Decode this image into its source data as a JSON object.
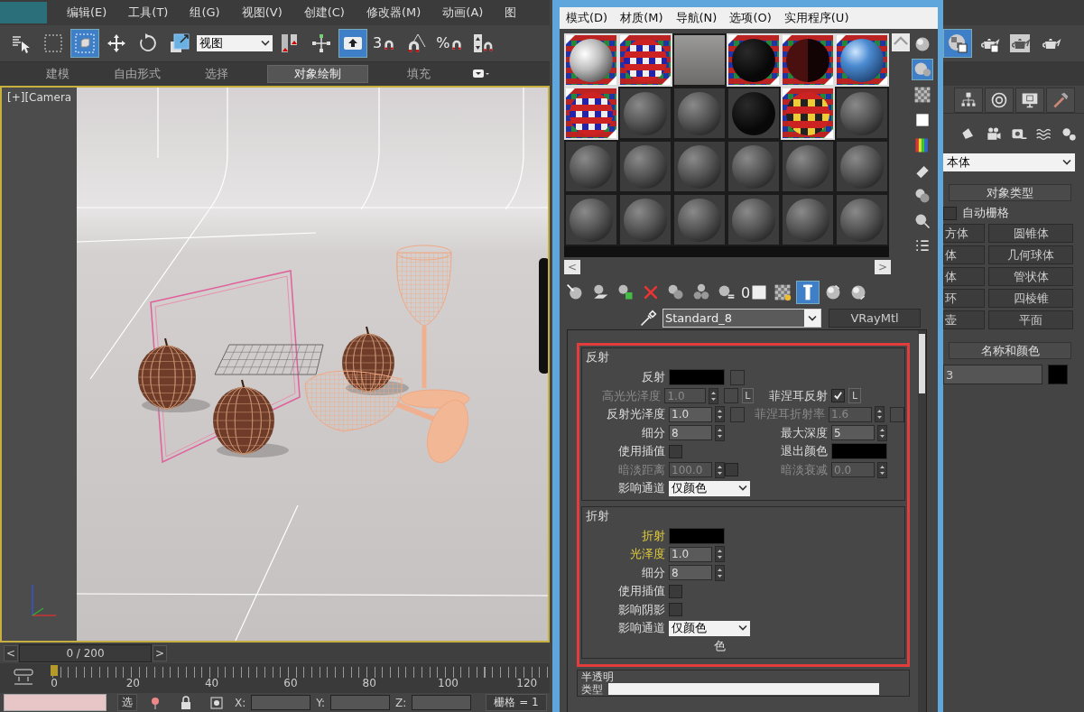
{
  "main_menu": [
    "编辑(E)",
    "工具(T)",
    "组(G)",
    "视图(V)",
    "创建(C)",
    "修改器(M)",
    "动画(A)",
    "图"
  ],
  "main_toolbar": [
    {
      "kind": "select",
      "active": false
    },
    {
      "kind": "region",
      "active": false
    },
    {
      "kind": "crossing",
      "active": true
    },
    {
      "kind": "move",
      "active": false
    },
    {
      "kind": "rotate",
      "active": false
    },
    {
      "kind": "scale",
      "active": false
    },
    {
      "kind": "dropdown",
      "value": "视图"
    },
    {
      "kind": "pivot",
      "active": false
    },
    {
      "kind": "manipulate",
      "active": false
    },
    {
      "kind": "shortcut",
      "active": true
    },
    {
      "kind": "snap",
      "label": "3",
      "active": false
    },
    {
      "kind": "angle-snap",
      "active": false
    },
    {
      "kind": "percent-snap",
      "label": "%",
      "active": false
    },
    {
      "kind": "spinner-snap",
      "active": false
    }
  ],
  "ribbon_tabs": [
    {
      "label": "建模",
      "selected": false
    },
    {
      "label": "自由形式",
      "selected": false
    },
    {
      "label": "选择",
      "selected": false
    },
    {
      "label": "对象绘制",
      "selected": true
    },
    {
      "label": "填充",
      "selected": false
    }
  ],
  "viewport": {
    "label": "[+][Camera",
    "active": true
  },
  "time_slider": {
    "prev": "<",
    "position": "0 / 200",
    "next": ">",
    "level": 0
  },
  "track_bar": {
    "labels": [
      "0",
      "20",
      "40",
      "60",
      "80",
      "100",
      "120"
    ]
  },
  "status_bar": {
    "mode": "选",
    "x_label": "X:",
    "y_label": "Y:",
    "z_label": "Z:",
    "grid": "栅格 = 1"
  },
  "command_panel": {
    "toolbar": [
      {
        "kind": "material-editor",
        "active": true
      },
      {
        "kind": "render-setup",
        "active": false
      },
      {
        "kind": "rendered-frame",
        "active": false
      },
      {
        "kind": "render",
        "active": false
      }
    ],
    "tabs": [
      {
        "kind": "hierarchy"
      },
      {
        "kind": "motion"
      },
      {
        "kind": "display"
      },
      {
        "kind": "utilities"
      }
    ],
    "categories": [
      {
        "kind": "light"
      },
      {
        "kind": "camera"
      },
      {
        "kind": "helper"
      },
      {
        "kind": "space-warp"
      },
      {
        "kind": "system"
      }
    ],
    "type_dropdown": "本体",
    "object_type": {
      "title": "对象类型",
      "autogrid": {
        "label": "自动栅格",
        "checked": false
      },
      "buttons": [
        "方体",
        "圆锥体",
        "体",
        "几何球体",
        "体",
        "管状体",
        "环",
        "四棱锥",
        "壶",
        "平面"
      ]
    },
    "name_color": {
      "title": "名称和颜色",
      "name": "3",
      "color": "#000000"
    }
  },
  "material_editor": {
    "menu": [
      "模式(D)",
      "材质(M)",
      "导航(N)",
      "选项(O)",
      "实用程序(U)"
    ],
    "slots": [
      {
        "kind": "white",
        "in_scene": true
      },
      {
        "kind": "checker",
        "in_scene": true
      },
      {
        "kind": "photo",
        "in_scene": false
      },
      {
        "kind": "black",
        "in_scene": true
      },
      {
        "kind": "dark-red",
        "in_scene": true
      },
      {
        "kind": "blue",
        "in_scene": true
      },
      {
        "kind": "checker",
        "in_scene": true
      },
      {
        "kind": "grey",
        "in_scene": false
      },
      {
        "kind": "grey",
        "in_scene": false
      },
      {
        "kind": "black",
        "in_scene": false
      },
      {
        "kind": "red-yellow",
        "in_scene": true
      },
      {
        "kind": "grey",
        "in_scene": false
      },
      {
        "kind": "grey",
        "in_scene": false
      },
      {
        "kind": "grey",
        "in_scene": false
      },
      {
        "kind": "grey",
        "in_scene": false
      },
      {
        "kind": "grey",
        "in_scene": false
      },
      {
        "kind": "grey",
        "in_scene": false
      },
      {
        "kind": "grey",
        "in_scene": false
      },
      {
        "kind": "grey",
        "in_scene": false
      },
      {
        "kind": "grey",
        "in_scene": false
      },
      {
        "kind": "grey",
        "in_scene": false
      },
      {
        "kind": "grey",
        "in_scene": false
      },
      {
        "kind": "grey",
        "in_scene": false
      },
      {
        "kind": "grey",
        "in_scene": false
      }
    ],
    "side_toolbar": [
      {
        "kind": "sphere",
        "active": false
      },
      {
        "kind": "backlight",
        "active": true
      },
      {
        "kind": "checker",
        "active": false
      },
      {
        "kind": "square",
        "active": false
      },
      {
        "kind": "color-bars",
        "active": false
      },
      {
        "kind": "tiling",
        "active": false
      },
      {
        "kind": "video-check",
        "active": false
      },
      {
        "kind": "magnify",
        "active": false
      },
      {
        "kind": "select-by",
        "active": false
      }
    ],
    "nav": {
      "prev": "<",
      "next": ">"
    },
    "toolbar": [
      {
        "kind": "get",
        "active": false
      },
      {
        "kind": "put",
        "active": false
      },
      {
        "kind": "assign",
        "active": false
      },
      {
        "kind": "delete",
        "active": false
      },
      {
        "kind": "copy",
        "active": false
      },
      {
        "kind": "unique",
        "active": false
      },
      {
        "kind": "library",
        "active": false
      },
      {
        "kind": "material-id",
        "label": "0",
        "active": false
      },
      {
        "kind": "show-map",
        "active": false
      },
      {
        "kind": "end-result",
        "active": true
      },
      {
        "kind": "parent",
        "active": false
      },
      {
        "kind": "sibling",
        "active": false
      }
    ],
    "material_name": "Standard_8",
    "material_type": "VRayMtl",
    "highlight": true,
    "groups": [
      {
        "title": "反射",
        "rows": [
          {
            "left": {
              "label": "反射",
              "kind": "color",
              "color": "#000000",
              "disabled": false,
              "highlighted": false,
              "extras": [
                {
                  "kind": "map"
                }
              ]
            }
          },
          {
            "left": {
              "label": "高光光泽度",
              "kind": "spinner",
              "value": "1.0",
              "disabled": true,
              "highlighted": false,
              "extras": [
                {
                  "kind": "map"
                },
                {
                  "kind": "lock",
                  "label": "L"
                }
              ]
            },
            "right": {
              "label": "菲涅耳反射",
              "kind": "checkbox",
              "checked": true,
              "disabled": false,
              "highlighted": false,
              "extras": [
                {
                  "kind": "lock",
                  "label": "L"
                }
              ]
            }
          },
          {
            "left": {
              "label": "反射光泽度",
              "kind": "spinner",
              "value": "1.0",
              "disabled": false,
              "highlighted": false,
              "extras": [
                {
                  "kind": "map"
                }
              ]
            },
            "right": {
              "label": "菲涅耳折射率",
              "kind": "spinner",
              "value": "1.6",
              "disabled": true,
              "highlighted": false,
              "extras": [
                {
                  "kind": "map"
                }
              ]
            }
          },
          {
            "left": {
              "label": "细分",
              "kind": "spinner",
              "value": "8",
              "disabled": false,
              "highlighted": false
            },
            "right": {
              "label": "最大深度",
              "kind": "spinner",
              "value": "5",
              "disabled": false,
              "highlighted": false
            }
          },
          {
            "left": {
              "label": "使用插值",
              "kind": "checkbox",
              "checked": false,
              "disabled": false,
              "highlighted": false
            },
            "right": {
              "label": "退出颜色",
              "kind": "color",
              "color": "#000000",
              "disabled": false,
              "highlighted": false
            }
          },
          {
            "left": {
              "label": "暗淡距离",
              "kind": "spinner",
              "value": "100.0",
              "disabled": true,
              "highlighted": false,
              "extras": [
                {
                  "kind": "checkbox",
                  "checked": false
                }
              ]
            },
            "right": {
              "label": "暗淡衰减",
              "kind": "spinner",
              "value": "0.0",
              "disabled": true,
              "highlighted": false
            }
          },
          {
            "left": {
              "label": "影响通道",
              "kind": "dropdown",
              "value": "仅颜色",
              "disabled": false,
              "highlighted": false
            }
          }
        ]
      },
      {
        "title": "折射",
        "rows": [
          {
            "left": {
              "label": "折射",
              "kind": "color",
              "color": "#000000",
              "disabled": false,
              "highlighted": true
            }
          },
          {
            "left": {
              "label": "光泽度",
              "kind": "spinner",
              "value": "1.0",
              "disabled": false,
              "highlighted": true
            }
          },
          {
            "left": {
              "label": "细分",
              "kind": "spinner",
              "value": "8",
              "disabled": false,
              "highlighted": false
            }
          },
          {
            "left": {
              "label": "使用插值",
              "kind": "checkbox",
              "checked": false,
              "disabled": false,
              "highlighted": false
            }
          },
          {
            "left": {
              "label": "影响阴影",
              "kind": "checkbox",
              "checked": false,
              "disabled": false,
              "highlighted": false
            }
          },
          {
            "left": {
              "label": "影响通道",
              "kind": "dropdown",
              "value": "仅颜色",
              "disabled": false,
              "highlighted": false
            }
          },
          {
            "caption": "色"
          }
        ]
      }
    ],
    "translucency": {
      "title": "半透明",
      "type_label": "类型"
    }
  }
}
